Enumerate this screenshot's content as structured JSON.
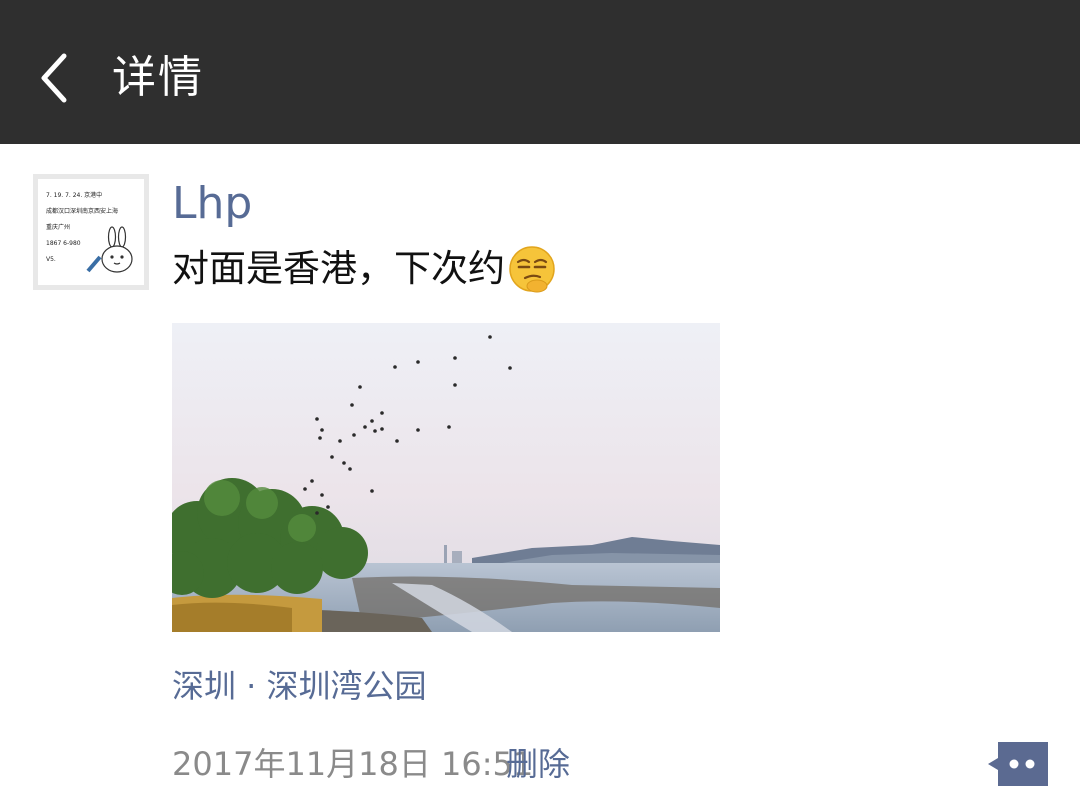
{
  "header": {
    "title": "详情",
    "back_icon": "chevron-left-icon"
  },
  "post": {
    "username": "Lhp",
    "text": "对面是香港，下次约",
    "emoji": "smirk-face-emoji",
    "location": "深圳 · 深圳湾公园",
    "timestamp": "2017年11月18日 16:51",
    "delete_label": "删除",
    "more_icon": "comment-more-icon"
  },
  "avatar": {
    "lines": [
      "7. 19. 7. 24. 京港中",
      "成都汉口深圳南京西安上海",
      "重庆广州",
      "1867 6-980",
      "V5."
    ]
  },
  "colors": {
    "header_bg": "#2f2f2f",
    "link": "#576b95",
    "text": "#111111",
    "muted": "#8a8a8a",
    "more_button_bg": "#5b6a91"
  }
}
